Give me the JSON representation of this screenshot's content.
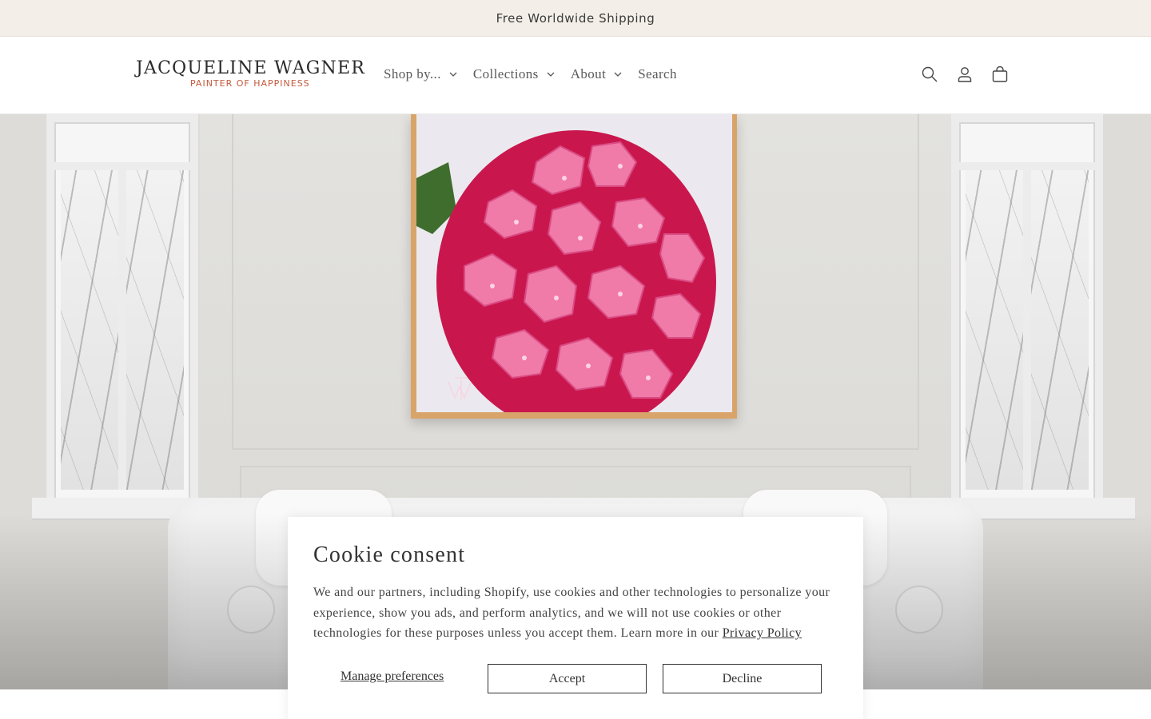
{
  "announcement": {
    "text": "Free Worldwide Shipping"
  },
  "header": {
    "logo": {
      "name": "JACQUELINE WAGNER",
      "tagline": "PAINTER OF HAPPINESS"
    },
    "nav": [
      {
        "label": "Shop by...",
        "has_dropdown": true
      },
      {
        "label": "Collections",
        "has_dropdown": true
      },
      {
        "label": "About",
        "has_dropdown": true
      },
      {
        "label": "Search",
        "has_dropdown": false
      }
    ],
    "icons": [
      "search-icon",
      "account-icon",
      "cart-icon"
    ]
  },
  "hero": {
    "image": "painting-of-pink-hydrangea-in-living-room"
  },
  "cookie": {
    "title": "Cookie consent",
    "body": "We and our partners, including Shopify, use cookies and other technologies to personalize your experience, show you ads, and perform analytics, and we will not use cookies or other technologies for these purposes unless you accept them. Learn more in our ",
    "link": "Privacy Policy",
    "manage_label": "Manage preferences",
    "accept_label": "Accept",
    "decline_label": "Decline"
  },
  "colors": {
    "announcement_bg": "#f3efe8",
    "tagline": "#c45a3c",
    "hydrangea": "#e94f86",
    "frame": "#d9a46a"
  }
}
